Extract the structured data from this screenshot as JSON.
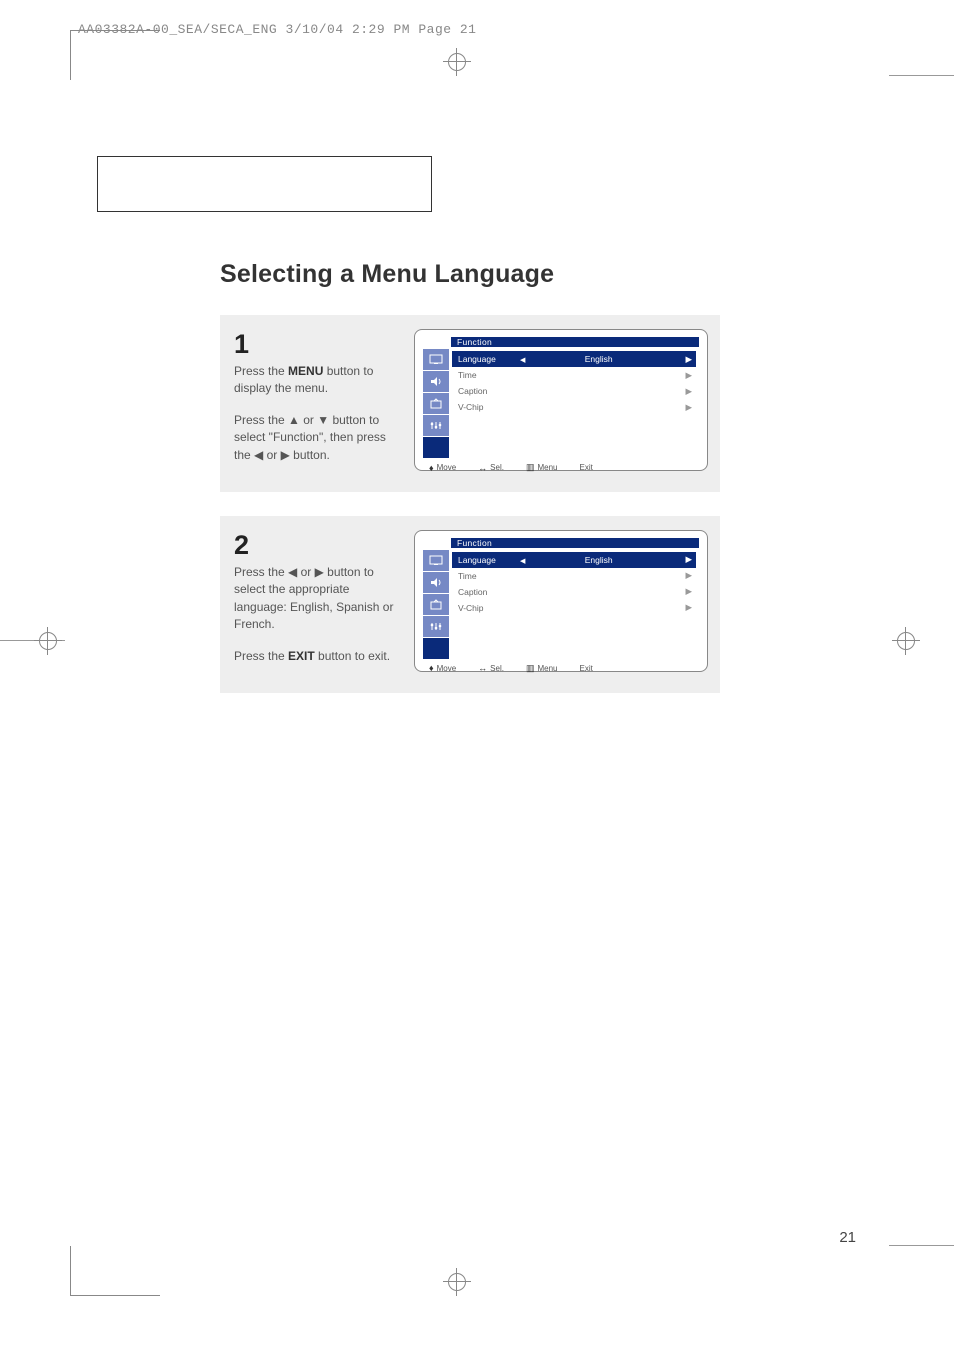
{
  "print_header": "AA03382A-00_SEA/SECA_ENG  3/10/04  2:29 PM  Page 21",
  "page_number": "21",
  "main_title": "Selecting a Menu Language",
  "steps": [
    {
      "num": "1",
      "paras": [
        {
          "pre": "Press the ",
          "bold": "MENU",
          "post": " button to display the menu."
        },
        {
          "pre": "Press the ▲ or ▼ button to select \"Function\", then press the ◀ or ▶ button.",
          "bold": "",
          "post": ""
        }
      ]
    },
    {
      "num": "2",
      "paras": [
        {
          "pre": "Press the ◀ or ▶ button to select the appropriate language: English, Spanish or French.",
          "bold": "",
          "post": ""
        },
        {
          "pre": "Press the ",
          "bold": "EXIT",
          "post": " button to exit."
        }
      ]
    }
  ],
  "osd": {
    "title": "Function",
    "rows": [
      {
        "label": "Language",
        "val": "English",
        "arrow_l": true,
        "arrow_r": true
      },
      {
        "label": "Time",
        "val": "",
        "arrow_l": false,
        "arrow_r": true
      },
      {
        "label": "Caption",
        "val": "",
        "arrow_l": false,
        "arrow_r": true
      },
      {
        "label": "V-Chip",
        "val": "",
        "arrow_l": false,
        "arrow_r": true
      }
    ],
    "footer": {
      "move": "Move",
      "sel": "Sel.",
      "menu": "Menu",
      "exit": "Exit"
    }
  }
}
